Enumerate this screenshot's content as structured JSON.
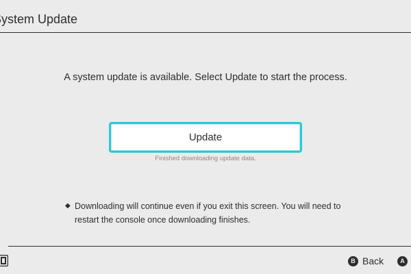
{
  "header": {
    "title": "System Update"
  },
  "main": {
    "message": "A system update is available. Select Update to start the process.",
    "update_button_label": "Update",
    "status_text": "Finished downloading update data.",
    "note_bullet": "◆",
    "note_lines": [
      "Downloading will continue even if you exit this screen. You will need to",
      "restart the console once downloading finishes."
    ]
  },
  "footer": {
    "back_glyph": "B",
    "back_label": "Back",
    "a_glyph": "A",
    "a_label": ""
  },
  "colors": {
    "background": "#ebebeb",
    "text": "#2d2d2d",
    "accent": "#2ec7d6",
    "muted": "#8a8a8a"
  },
  "icons": {
    "controller": "controller-icon"
  }
}
